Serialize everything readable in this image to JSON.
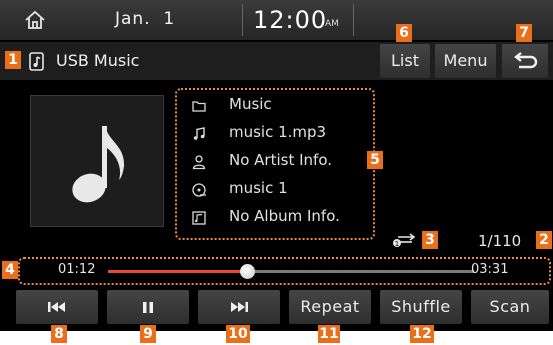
{
  "status_bar": {
    "date": "Jan.  1",
    "time": "12:00",
    "ampm": "AM"
  },
  "source": {
    "title": "USB Music"
  },
  "top_buttons": {
    "list": "List",
    "menu": "Menu"
  },
  "track_info": {
    "folder": "Music",
    "file": "music 1.mp3",
    "artist": "No Artist Info.",
    "title": "music 1",
    "album": "No Album Info."
  },
  "track_count": "1/110",
  "progress": {
    "elapsed": "01:12",
    "total": "03:31",
    "fraction": 0.38
  },
  "controls": {
    "repeat": "Repeat",
    "shuffle": "Shuffle",
    "scan": "Scan"
  },
  "callouts": {
    "c1": "1",
    "c2": "2",
    "c3": "3",
    "c4": "4",
    "c5": "5",
    "c6": "6",
    "c7": "7",
    "c8": "8",
    "c9": "9",
    "c10": "10",
    "c11": "11",
    "c12": "12"
  },
  "colors": {
    "accent": "#e74c2e",
    "callout": "#ea6f1b",
    "highlight_border": "#ea8a3c"
  },
  "icons": [
    "home-icon",
    "usb-music-icon",
    "back-icon",
    "music-note-icon",
    "folder-icon",
    "file-icon",
    "artist-icon",
    "title-icon",
    "album-icon",
    "repeat-one-icon",
    "previous-icon",
    "pause-icon",
    "next-icon"
  ]
}
